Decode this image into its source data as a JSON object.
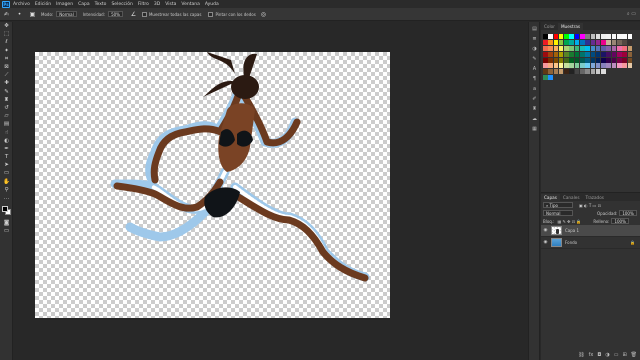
{
  "menubar": {
    "logo": "Ps",
    "items": [
      "Archivo",
      "Edición",
      "Imagen",
      "Capa",
      "Texto",
      "Selección",
      "Filtro",
      "3D",
      "Vista",
      "Ventana",
      "Ayuda"
    ]
  },
  "options": {
    "mode_label": "Modo:",
    "mode_value": "Normal",
    "intensity_label": "Intensidad:",
    "intensity_value": "50%",
    "sample_all_label": "Muestrear todas las capas",
    "finger_label": "Pintar con los dedos"
  },
  "tools": [
    "move-tool",
    "marquee-tool",
    "lasso-tool",
    "quick-select-tool",
    "crop-tool",
    "frame-tool",
    "eyedropper-tool",
    "healing-tool",
    "brush-tool",
    "clone-stamp-tool",
    "history-brush-tool",
    "eraser-tool",
    "gradient-tool",
    "smudge-tool",
    "dodge-tool",
    "pen-tool",
    "type-tool",
    "path-select-tool",
    "rectangle-tool",
    "hand-tool",
    "zoom-tool"
  ],
  "right_panel": {
    "tabs": [
      "Color",
      "Muestras"
    ],
    "active_tab": "Muestras"
  },
  "layers_panel": {
    "tabs": [
      "Capas",
      "Canales",
      "Trazados"
    ],
    "active_tab": "Capas",
    "filter_label": "Tipo",
    "blend_mode": "Normal",
    "opacity_label": "Opacidad:",
    "opacity_value": "100%",
    "lock_label": "Bloq.:",
    "fill_label": "Relleno:",
    "fill_value": "100%",
    "layers": [
      {
        "name": "Capa 1",
        "selected": true
      },
      {
        "name": "Fondo",
        "selected": false
      }
    ]
  },
  "colors": {
    "swatch_rows": [
      [
        "#000000",
        "#ffffff",
        "#ff0000",
        "#ffff00",
        "#00ff00",
        "#00ffff",
        "#0000ff",
        "#ff00ff",
        "#808080",
        "#c0c0c0",
        "#e0e0e0",
        "#f0f0f0",
        "#f4f4f4",
        "#f8f8f8",
        "#fafafa",
        "#fcfcfc",
        "#ffffff"
      ],
      [
        "#ed1c24",
        "#f7941d",
        "#fff200",
        "#8dc63f",
        "#00a651",
        "#00a99d",
        "#00aeef",
        "#0072bc",
        "#2e3192",
        "#662d91",
        "#92278f",
        "#ec008c",
        "#c7b299",
        "#998675",
        "#736357",
        "#534741",
        "#362f2d"
      ],
      [
        "#f26c4f",
        "#f68e56",
        "#fbaf5d",
        "#fff568",
        "#acd373",
        "#7cc576",
        "#3bb878",
        "#1abbb4",
        "#00bff3",
        "#438ccb",
        "#5574b9",
        "#605ca8",
        "#8560a8",
        "#a864a8",
        "#f06eaa",
        "#f26d7d",
        "#c69c6d"
      ],
      [
        "#9e0b0f",
        "#a0410d",
        "#a36209",
        "#aba000",
        "#598527",
        "#197b30",
        "#007236",
        "#00746b",
        "#0076a3",
        "#004a80",
        "#003471",
        "#1b1464",
        "#440e62",
        "#630460",
        "#9e005d",
        "#9e0039",
        "#8c6239"
      ],
      [
        "#790000",
        "#7b2e00",
        "#7d4900",
        "#827b00",
        "#406618",
        "#005e20",
        "#005826",
        "#005952",
        "#005b7f",
        "#003663",
        "#002157",
        "#0d004c",
        "#32004b",
        "#4b0049",
        "#7b0046",
        "#7a0026",
        "#754c24"
      ],
      [
        "#f5989d",
        "#f9ad81",
        "#fdc68a",
        "#fff799",
        "#c4df9b",
        "#a3d39c",
        "#82ca9c",
        "#7accc8",
        "#6dcff6",
        "#7ea7d8",
        "#8393ca",
        "#8781bd",
        "#a187be",
        "#bc8dbf",
        "#f49ac2",
        "#f6989d",
        "#e6c9a8"
      ],
      [
        "#603913",
        "#8c6239",
        "#a67c52",
        "#c69c6d",
        "#3b2314",
        "#222222",
        "#444444",
        "#666666",
        "#888888",
        "#aaaaaa",
        "#cccccc",
        "#dddddd"
      ],
      [
        "#2e8b57",
        "#1e90ff"
      ]
    ]
  }
}
